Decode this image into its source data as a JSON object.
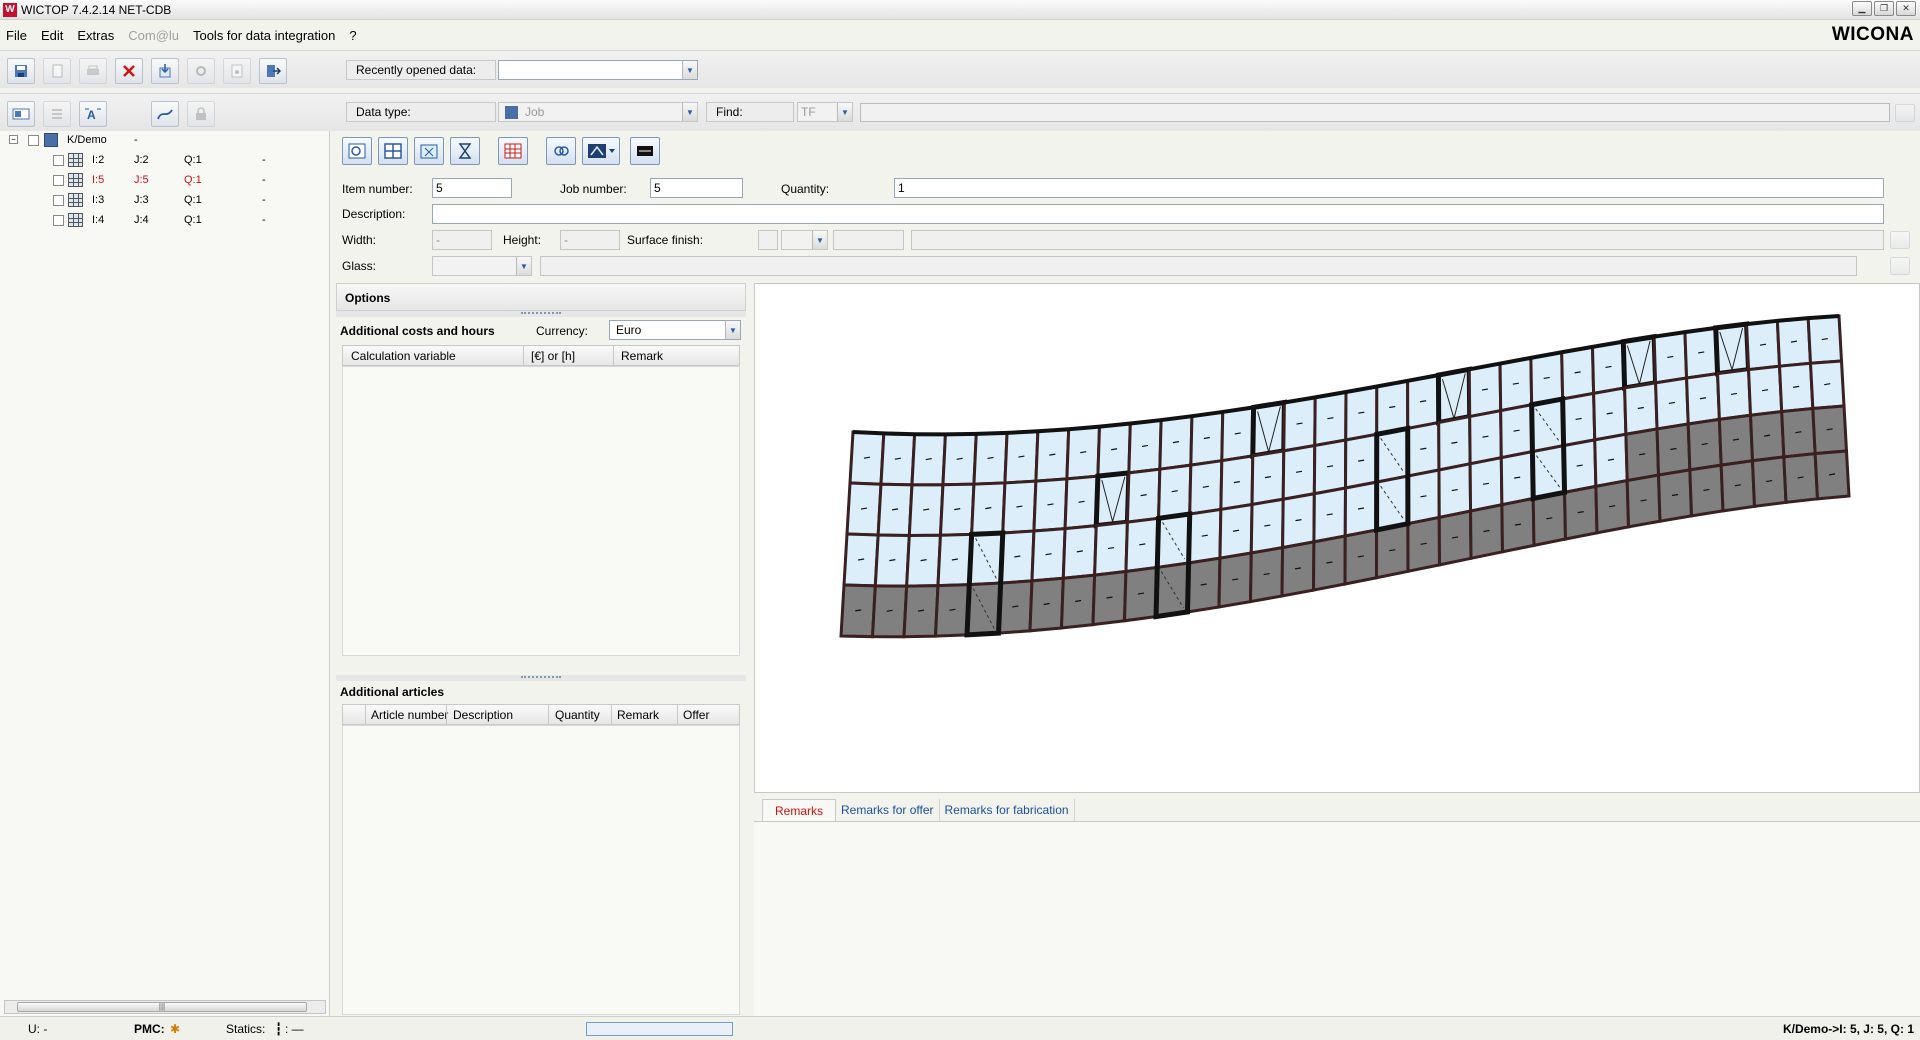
{
  "window": {
    "title": "WICTOP 7.4.2.14 NET-CDB",
    "brand": "WICONA"
  },
  "menu": [
    "File",
    "Edit",
    "Extras",
    "Com@lu",
    "Tools for data integration",
    "?"
  ],
  "toolbar1": {
    "recent_label": "Recently opened data:",
    "recent_value": ""
  },
  "toolbar2": {
    "data_type_label": "Data type:",
    "data_type_value": "Job",
    "find_label": "Find:",
    "find_value": "TF"
  },
  "tree": {
    "root": {
      "label": "K/Demo",
      "extra": "-"
    },
    "items": [
      {
        "item": "I:2",
        "job": "J:2",
        "qty": "Q:1",
        "extra": "-",
        "selected": false
      },
      {
        "item": "I:5",
        "job": "J:5",
        "qty": "Q:1",
        "extra": "-",
        "selected": true
      },
      {
        "item": "I:3",
        "job": "J:3",
        "qty": "Q:1",
        "extra": "-",
        "selected": false
      },
      {
        "item": "I:4",
        "job": "J:4",
        "qty": "Q:1",
        "extra": "-",
        "selected": false
      }
    ]
  },
  "form": {
    "item_number_label": "Item number:",
    "item_number": "5",
    "job_number_label": "Job number:",
    "job_number": "5",
    "quantity_label": "Quantity:",
    "quantity": "1",
    "description_label": "Description:",
    "description": "",
    "width_label": "Width:",
    "width": "-",
    "height_label": "Height:",
    "height": "-",
    "surface_label": "Surface finish:",
    "glass_label": "Glass:"
  },
  "options": {
    "title": "Options",
    "costs_title": "Additional costs and hours",
    "currency_label": "Currency:",
    "currency_value": "Euro",
    "costs_columns": [
      "Calculation variable",
      "[€] or [h]",
      "Remark"
    ],
    "articles_title": "Additional articles",
    "articles_columns": [
      "Article number",
      "Description",
      "Quantity",
      "Remark",
      "Offer"
    ]
  },
  "remarks": {
    "tabs": [
      "Remarks",
      "Remarks for offer",
      "Remarks for fabrication"
    ],
    "active_tab": "Remarks"
  },
  "status": {
    "u": "U: -",
    "pmc": "PMC:",
    "statics": "Statics:",
    "statics_value": ": —",
    "path": "K/Demo->I: 5, J: 5, Q: 1"
  },
  "colors": {
    "glass": "#dbeefa",
    "panel": "#808080",
    "frame": "#3a2020",
    "selected": "#d01010"
  }
}
